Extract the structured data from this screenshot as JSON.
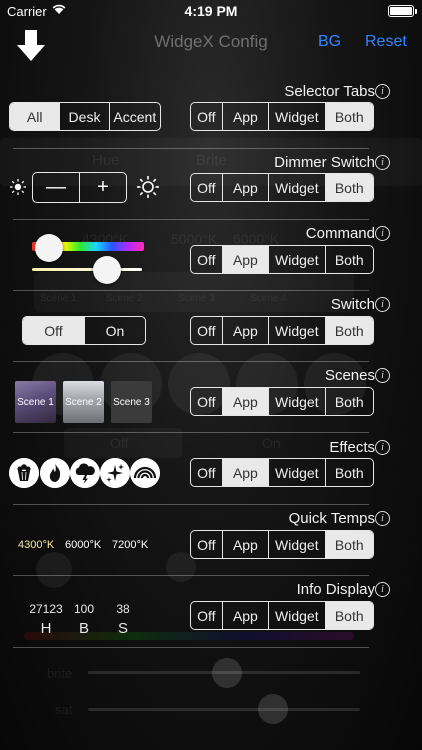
{
  "status": {
    "carrier": "Carrier",
    "time": "4:19 PM"
  },
  "nav": {
    "title": "WidgeX Config",
    "bg_label": "BG",
    "reset_label": "Reset"
  },
  "visibility_options": [
    "Off",
    "App",
    "Widget",
    "Both"
  ],
  "sections": [
    {
      "label": "Selector Tabs",
      "selected": "Both"
    },
    {
      "label": "Dimmer Switch",
      "selected": "Both"
    },
    {
      "label": "Command",
      "selected": "App"
    },
    {
      "label": "Switch",
      "selected": "Both"
    },
    {
      "label": "Scenes",
      "selected": "App"
    },
    {
      "label": "Effects",
      "selected": "App"
    },
    {
      "label": "Quick Temps",
      "selected": "Both"
    },
    {
      "label": "Info Display",
      "selected": "Both"
    }
  ],
  "info_glyph": "i",
  "previews": {
    "tabs": [
      "All",
      "Desk",
      "Accent"
    ],
    "tabs_selected": "All",
    "dimmer": {
      "minus": "—",
      "plus": "+"
    },
    "command": {
      "hue_position": 0.15,
      "brightness_position": 0.68
    },
    "switch": {
      "off": "Off",
      "on": "On",
      "selected": "Off"
    },
    "scenes": [
      "Scene 1",
      "Scene 2",
      "Scene 3"
    ],
    "effects_icons": [
      "popcorn-icon",
      "fire-icon",
      "storm-icon",
      "sparkle-icon",
      "rainbow-icon"
    ],
    "quick_temps": [
      {
        "label": "4300°K",
        "color": "#f4e9a8"
      },
      {
        "label": "6000°K",
        "color": "#ffffff"
      },
      {
        "label": "7200°K",
        "color": "#ffffff"
      }
    ],
    "info_display": [
      {
        "value": "27123",
        "letter": "H"
      },
      {
        "value": "100",
        "letter": "B"
      },
      {
        "value": "38",
        "letter": "S"
      }
    ]
  },
  "background_ghost": {
    "labels": [
      "Hue",
      "Brite",
      "Scene 1",
      "Scene 2",
      "Scene 3",
      "Scene 4",
      "Off",
      "On",
      "brite",
      "sat",
      "4300°K",
      "5000°K",
      "6000°K"
    ]
  },
  "colors": {
    "accent": "#2f86ff",
    "selected_segment": "#e9e9e9"
  }
}
